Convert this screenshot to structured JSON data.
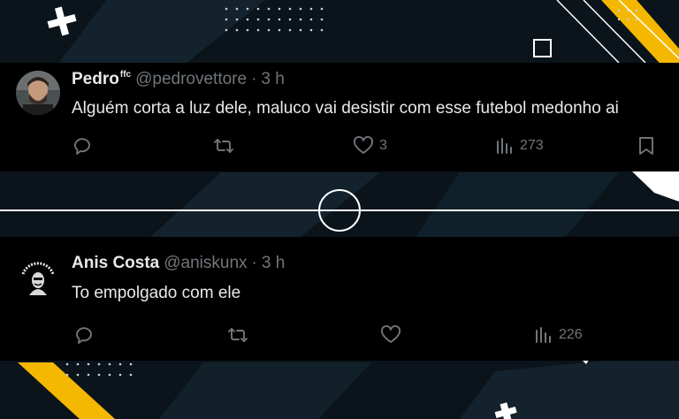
{
  "colors": {
    "background": "#0b141b",
    "tweet_bg": "#000000",
    "accent_yellow": "#f5b800",
    "text_primary": "#e7e9ea",
    "text_secondary": "#71767b"
  },
  "tweets": [
    {
      "name": "Pedro",
      "name_sup": "ffc",
      "handle": "@pedrovettore",
      "separator": "·",
      "time": "3 h",
      "text": "Alguém corta a luz dele, maluco vai desistir com esse futebol medonho ai",
      "likes": "3",
      "views": "273",
      "icons": [
        "reply-icon",
        "retweet-icon",
        "like-icon",
        "views-icon",
        "bookmark-icon"
      ]
    },
    {
      "name": "Anis Costa",
      "handle": "@aniskunx",
      "separator": "·",
      "time": "3 h",
      "text": "To empolgado com ele",
      "likes": "",
      "views": "226",
      "icons": [
        "reply-icon",
        "retweet-icon",
        "like-icon",
        "views-icon"
      ]
    }
  ]
}
